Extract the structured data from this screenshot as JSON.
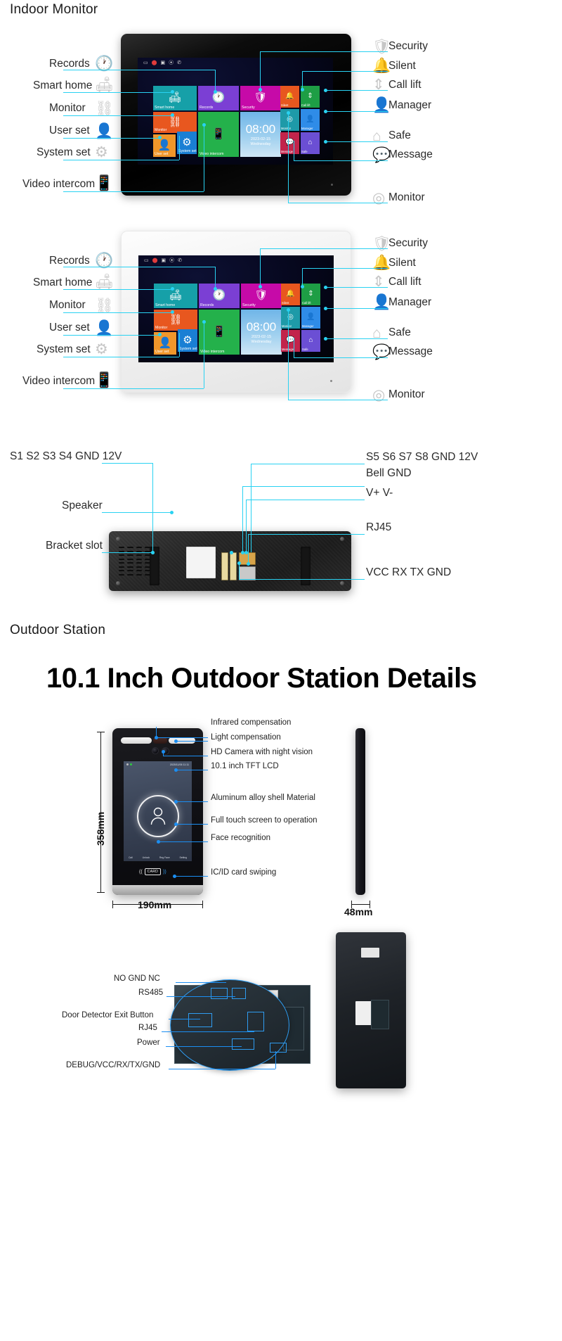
{
  "sections": {
    "indoor_title": "Indoor Monitor",
    "outdoor_title": "Outdoor Station",
    "outdoor_heading": "10.1 Inch Outdoor Station Details"
  },
  "indoor_left_callouts": [
    {
      "label": "Records",
      "icon": "clock-icon"
    },
    {
      "label": "Smart home",
      "icon": "sofa-icon"
    },
    {
      "label": "Monitor",
      "icon": "network-icon"
    },
    {
      "label": "User set",
      "icon": "user-icon"
    },
    {
      "label": "System set",
      "icon": "gear-icon"
    },
    {
      "label": "Video intercom",
      "icon": "handset-icon"
    }
  ],
  "indoor_right_callouts": [
    {
      "label": "Security",
      "icon": "shield-check-icon"
    },
    {
      "label": "Silent",
      "icon": "bell-icon"
    },
    {
      "label": "Call lift",
      "icon": "elevator-icon"
    },
    {
      "label": "Manager",
      "icon": "person-icon"
    },
    {
      "label": "Safe",
      "icon": "home-shield-icon"
    },
    {
      "label": "Message",
      "icon": "chat-icon"
    },
    {
      "label": "Monitor",
      "icon": "camera-icon"
    }
  ],
  "screen": {
    "status_icons": [
      "monitor-icon",
      "shield-icon",
      "picture-icon",
      "link-icon",
      "phone-icon"
    ],
    "tiles": [
      {
        "label": "Smart home",
        "icon": "sofa-icon",
        "color": "#16a0a8"
      },
      {
        "label": "Records",
        "icon": "clock-icon",
        "color": "#7b3fd4"
      },
      {
        "label": "Security",
        "icon": "shield-icon",
        "color": "#c60aa8"
      },
      {
        "label": "Monitor",
        "icon": "network-icon",
        "color": "#e8571f"
      },
      {
        "label": "Video intercom",
        "icon": "handset-icon",
        "color": "#24b14b"
      },
      {
        "label": "User set",
        "icon": "user-icon",
        "color": "#f0962a"
      },
      {
        "label": "System set",
        "icon": "gear-icon",
        "color": "#1a7fd4"
      }
    ],
    "side_tiles": [
      {
        "label": "Silent",
        "icon": "bell-icon",
        "color": "#e8571f"
      },
      {
        "label": "Call lift",
        "icon": "elevator-icon",
        "color": "#1e9e45"
      },
      {
        "label": "Monitor",
        "icon": "camera-icon",
        "color": "#1e9aa8"
      },
      {
        "label": "Manager",
        "icon": "person-icon",
        "color": "#2f8ce8"
      },
      {
        "label": "Message",
        "icon": "chat-icon",
        "color": "#c2244b"
      },
      {
        "label": "Safe",
        "icon": "home-shield-icon",
        "color": "#6b4fd4"
      }
    ],
    "clock_time": "08:00",
    "clock_date": "2023-02-15",
    "clock_day": "Wednesday"
  },
  "back_panel_callouts_left": [
    {
      "label": "S1 S2 S3 S4 GND 12V"
    },
    {
      "label": "Speaker"
    },
    {
      "label": "Bracket slot"
    }
  ],
  "back_panel_callouts_right": [
    {
      "label": "S5 S6 S7 S8 GND 12V"
    },
    {
      "label": "Bell GND"
    },
    {
      "label": "V+ V-"
    },
    {
      "label": "RJ45"
    },
    {
      "label": "VCC RX TX GND"
    }
  ],
  "outdoor_callouts": [
    {
      "label": "Infrared compensation"
    },
    {
      "label": "Light compensation"
    },
    {
      "label": "HD Camera with night vision"
    },
    {
      "label": "10.1 inch TFT LCD"
    },
    {
      "label": "Aluminum alloy shell Material"
    },
    {
      "label": "Full touch screen to operation"
    },
    {
      "label": "Face recognition"
    },
    {
      "label": "IC/ID card swiping"
    }
  ],
  "outdoor_screen": {
    "time": "2025/11/06 11:11",
    "menu": [
      "Call",
      "Unlock",
      "Reg Face",
      "Setting"
    ],
    "card_text": "CARD"
  },
  "dimensions": {
    "height": "358mm",
    "width": "190mm",
    "depth": "48mm"
  },
  "pcb_callouts": [
    {
      "label": "NO GND NC"
    },
    {
      "label": "RS485"
    },
    {
      "label": "Door Detector Exit Button"
    },
    {
      "label": "RJ45"
    },
    {
      "label": "Power"
    },
    {
      "label": "DEBUG/VCC/RX/TX/GND"
    }
  ],
  "colors": {
    "lead_cyan": "#29d2f2",
    "lead_blue": "#1b8ef2"
  }
}
